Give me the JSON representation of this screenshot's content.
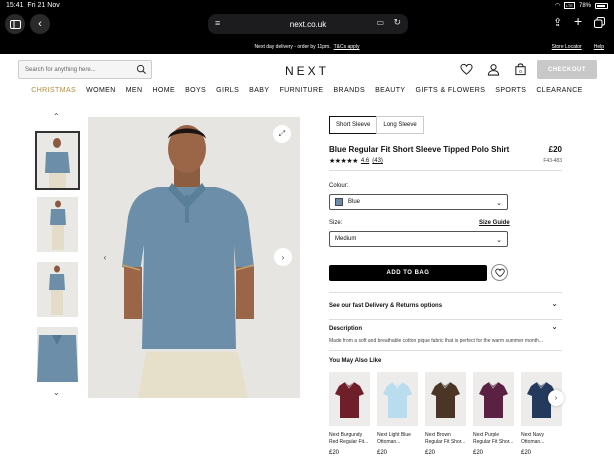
{
  "status_bar": {
    "time": "15:41",
    "date": "Fri 21 Nov",
    "battery": "78%",
    "network": "LTE"
  },
  "browser": {
    "url": "next.co.uk"
  },
  "promo": {
    "text": "Next day delivery - order by 11pm.",
    "link": "T&Cs apply",
    "store_locator": "Store Locator",
    "help": "Help"
  },
  "header": {
    "search_placeholder": "Search for anything here...",
    "logo": "NEXT",
    "checkout": "CHECKOUT"
  },
  "nav": [
    "CHRISTMAS",
    "WOMEN",
    "MEN",
    "HOME",
    "BOYS",
    "GIRLS",
    "BABY",
    "FURNITURE",
    "BRANDS",
    "BEAUTY",
    "GIFTS & FLOWERS",
    "SPORTS",
    "CLEARANCE"
  ],
  "product": {
    "tabs": [
      "Short Sleeve",
      "Long Sleeve"
    ],
    "name": "Blue Regular Fit Short Sleeve Tipped Polo Shirt",
    "price": "£20",
    "rating": "4.6",
    "review_count": "(43)",
    "code": "F43-483",
    "colour_label": "Colour:",
    "colour_value": "Blue",
    "size_label": "Size:",
    "size_guide": "Size Guide",
    "size_value": "Medium",
    "add_to_bag": "ADD TO BAG",
    "delivery": "See our fast Delivery & Returns options",
    "description_title": "Description",
    "description_text": "Made from a soft and breathable cotton pique fabric that is perfect for the warm summer month..."
  },
  "you_may_also_like": {
    "title": "You May Also Like",
    "items": [
      {
        "name": "Next Burgundy Red Regular Fit...",
        "price": "£20",
        "color": "#6e1f2a"
      },
      {
        "name": "Next Light Blue Ottoman...",
        "price": "£20",
        "color": "#b9dcef"
      },
      {
        "name": "Next Brown Regular Fit Shor...",
        "price": "£20",
        "color": "#4b3526"
      },
      {
        "name": "Next Purple Regular Fit Shor...",
        "price": "£20",
        "color": "#5a2143"
      },
      {
        "name": "Next Navy Ottoman...",
        "price": "£20",
        "color": "#243a5c"
      }
    ]
  },
  "colors": {
    "shirt": "#6c8ea8",
    "gold": "#b78a3f"
  }
}
